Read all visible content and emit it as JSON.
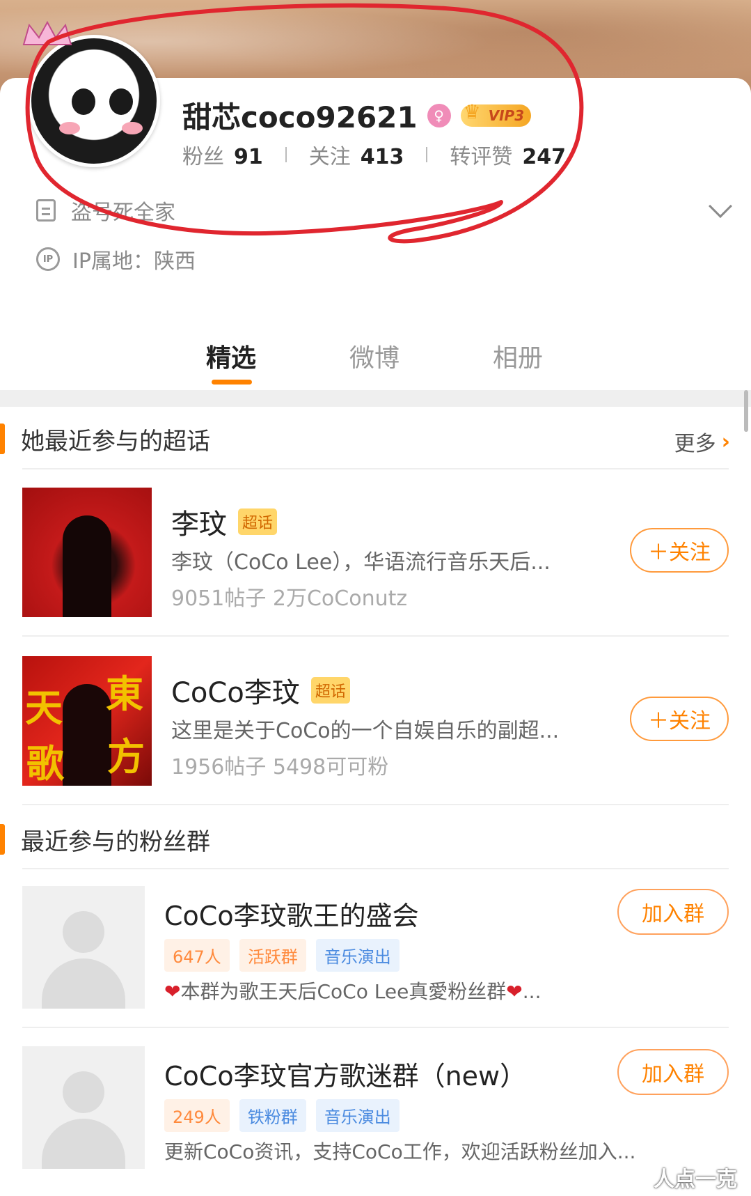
{
  "profile": {
    "username": "甜芯coco92621",
    "vip_label": "VIP3",
    "stats": [
      {
        "label": "粉丝",
        "value": "91"
      },
      {
        "label": "关注",
        "value": "413"
      },
      {
        "label": "转评赞",
        "value": "247"
      }
    ],
    "bio": "盗号死全家",
    "ip_location": "IP属地：陕西"
  },
  "tabs": [
    {
      "label": "精选",
      "active": true
    },
    {
      "label": "微博",
      "active": false
    },
    {
      "label": "相册",
      "active": false
    }
  ],
  "supertopics": {
    "title": "她最近参与的超话",
    "more_label": "更多",
    "badge_label": "超话",
    "follow_label": "＋关注",
    "items": [
      {
        "name": "李玟",
        "desc": "李玟（CoCo Lee），华语流行音乐天后...",
        "stats": "9051帖子 2万CoConutz"
      },
      {
        "name": "CoCo李玟",
        "desc": "这里是关于CoCo的一个自娱自乐的副超...",
        "stats": "1956帖子 5498可可粉"
      }
    ]
  },
  "fan_groups": {
    "title": "最近参与的粉丝群",
    "join_label": "加入群",
    "items": [
      {
        "name": "CoCo李玟歌王的盛会",
        "members": "647人",
        "type": "活跃群",
        "category": "音乐演出",
        "desc": "本群为歌王天后CoCo Lee真愛粉丝群",
        "desc_suffix": "..."
      },
      {
        "name": "CoCo李玟官方歌迷群（new）",
        "members": "249人",
        "type": "铁粉群",
        "category": "音乐演出",
        "desc": "更新CoCo资讯，支持CoCo工作，欢迎活跃粉丝加入..."
      }
    ]
  },
  "watermark": "人点一克",
  "colors": {
    "accent": "#ff8200",
    "annotation": "#e0262f",
    "tag_blue": "#4b8be0"
  }
}
